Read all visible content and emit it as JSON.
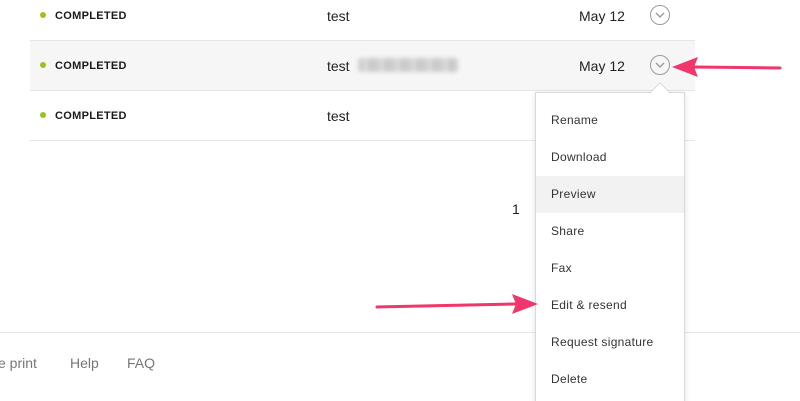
{
  "rows": [
    {
      "status": "COMPLETED",
      "name": "test",
      "date": "May 12"
    },
    {
      "status": "COMPLETED",
      "name": "test",
      "date": "May 12"
    },
    {
      "status": "COMPLETED",
      "name": "test",
      "date": ""
    }
  ],
  "pagination": {
    "current": "1"
  },
  "footer": {
    "links": [
      "e print",
      "Help",
      "FAQ"
    ]
  },
  "menu": {
    "items": [
      "Rename",
      "Download",
      "Preview",
      "Share",
      "Fax",
      "Edit & resend",
      "Request signature",
      "Delete"
    ],
    "active": "Preview"
  },
  "colors": {
    "status_dot": "#9bc31b",
    "annotation_arrow": "#f0366a"
  },
  "icons": {
    "row_menu": "chevron-down-icon"
  }
}
